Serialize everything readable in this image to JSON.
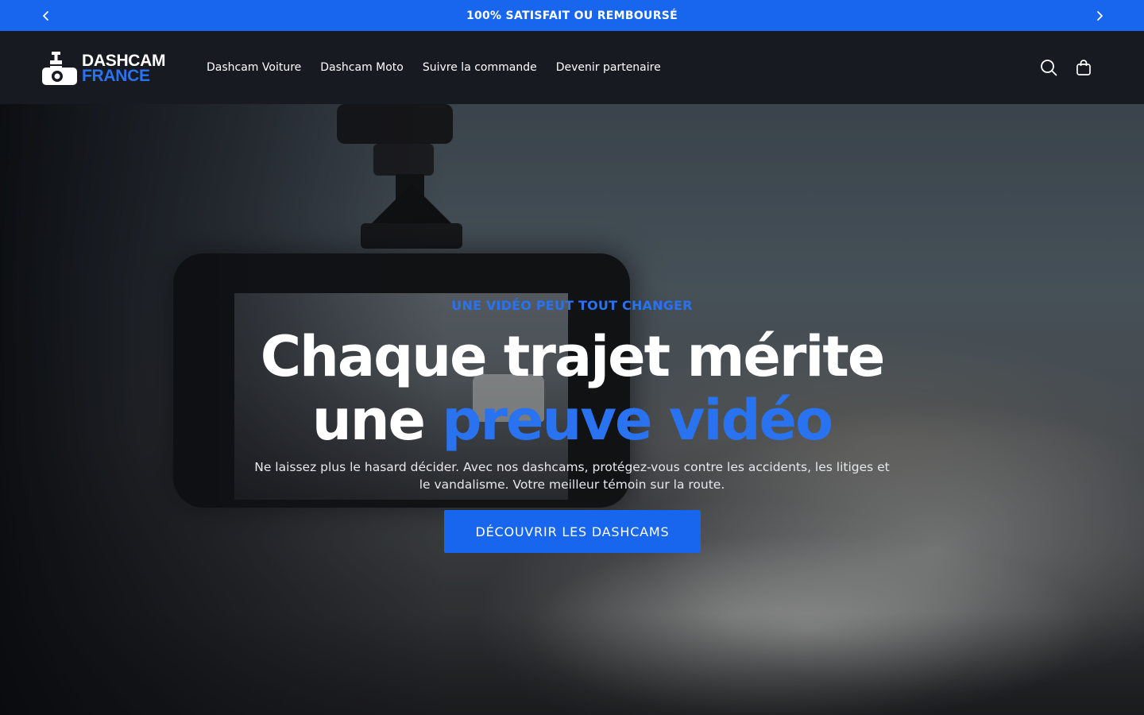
{
  "announcement": {
    "text": "100% SATISFAIT OU REMBOURSÉ",
    "prev_icon": "chevron-left-icon",
    "next_icon": "chevron-right-icon"
  },
  "header": {
    "logo": {
      "line1": "DASHCAM",
      "line2": "FRANCE",
      "icon": "dashcam-logo-icon"
    },
    "nav": [
      {
        "label": "Dashcam Voiture"
      },
      {
        "label": "Dashcam Moto"
      },
      {
        "label": "Suivre la commande"
      },
      {
        "label": "Devenir partenaire"
      }
    ],
    "icons": {
      "search": "search-icon",
      "cart": "shopping-bag-icon"
    }
  },
  "hero": {
    "eyebrow": "UNE VIDÉO PEUT TOUT CHANGER",
    "headline_line1": "Chaque trajet mérite",
    "headline_line2_plain": "une",
    "headline_line2_accent": "preuve vidéo",
    "subtext": "Ne laissez plus le hasard décider. Avec nos dashcams, protégez-vous contre les accidents, les litiges et le vandalisme. Votre meilleur témoin sur la route.",
    "cta_label": "DÉCOUVRIR LES DASHCAMS"
  },
  "colors": {
    "accent": "#1766ed",
    "accent_text": "#2a73f0",
    "header_bg": "#181a22"
  }
}
